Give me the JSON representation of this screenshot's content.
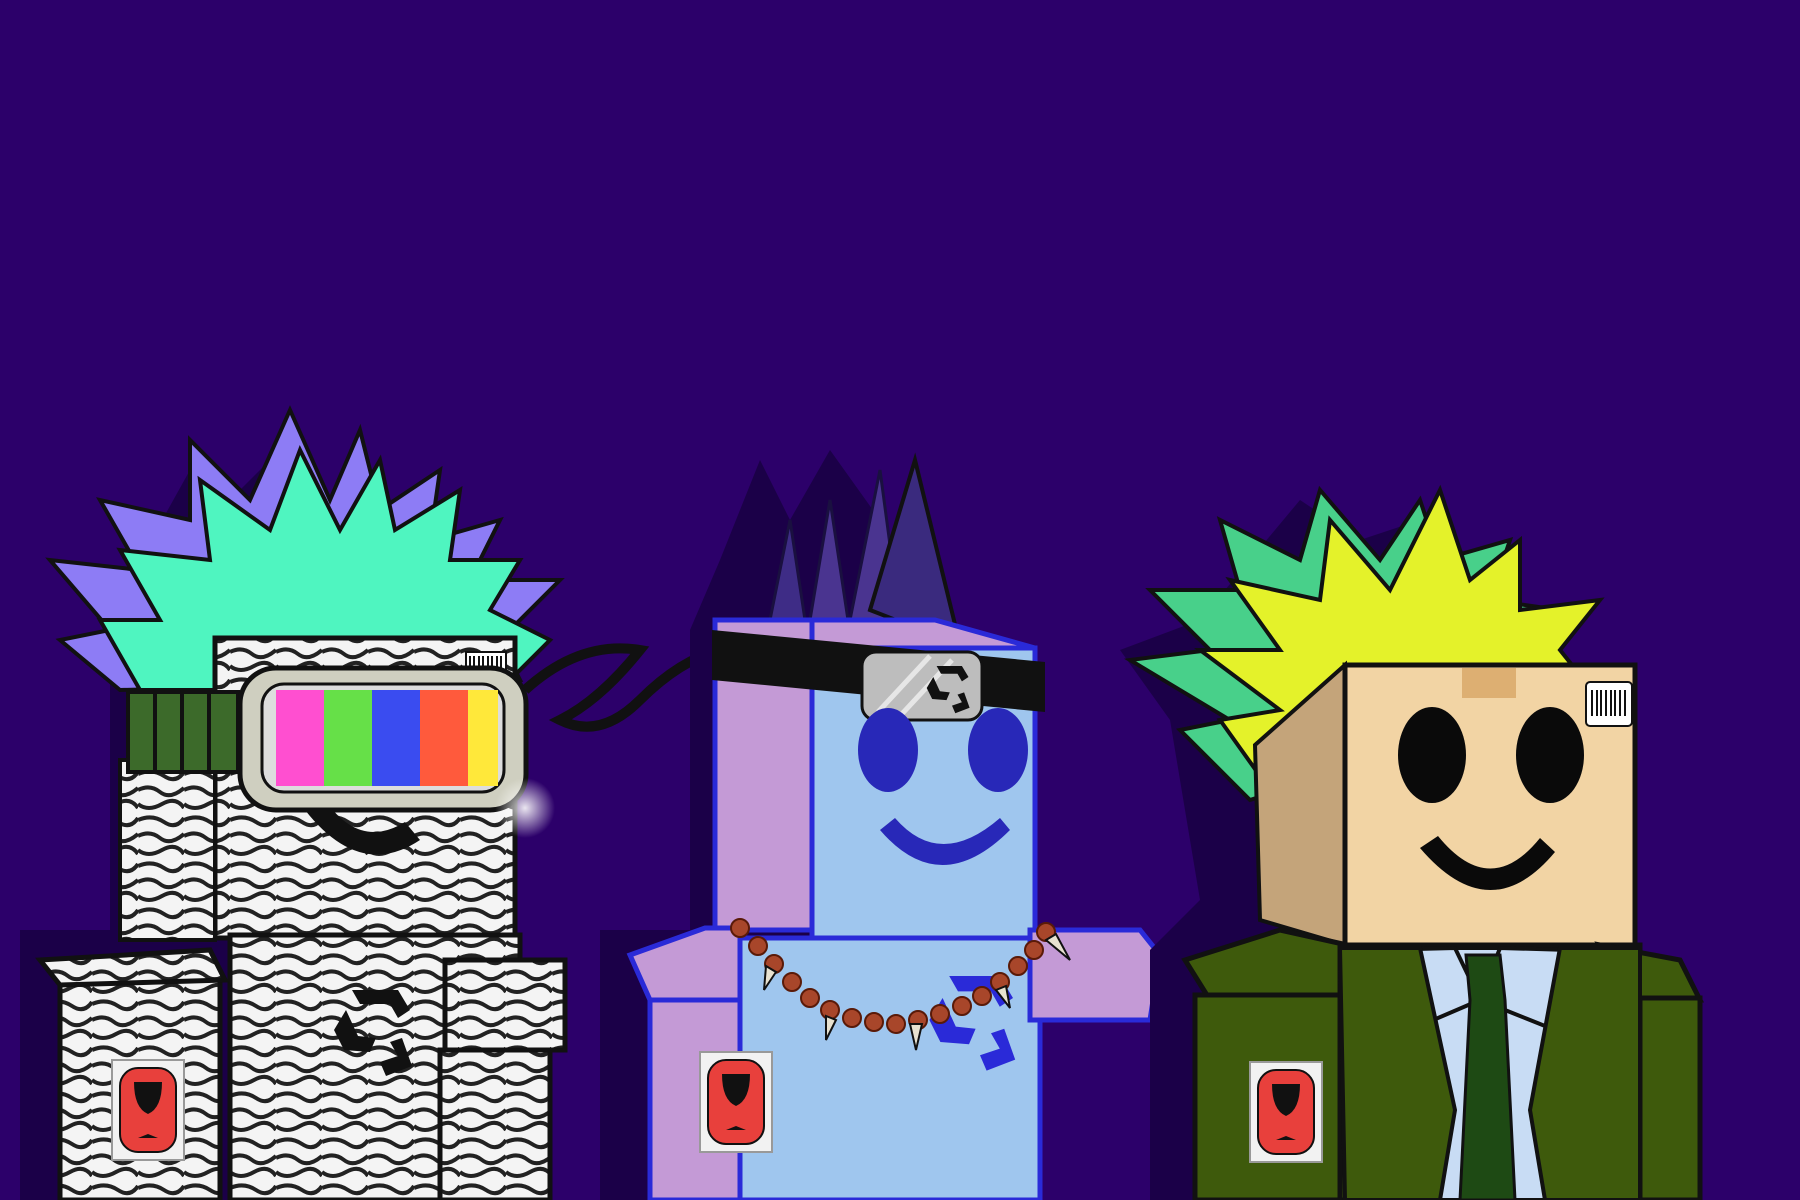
{
  "scene": {
    "background_color": "#2c006a",
    "shadow_color": "#1b0048",
    "characters": [
      {
        "name": "zebra-box-robot",
        "hair_colors": [
          "#4ff5c0",
          "#8d7cf5"
        ],
        "body_pattern": "zebra-stripes",
        "goggle_colors": [
          "#ff4fd0",
          "#66e048",
          "#3a4cf0",
          "#ff5a3c",
          "#ffe83a"
        ],
        "accessories": [
          "rainbow-visor-goggles",
          "recycle-symbol",
          "fragile-label"
        ]
      },
      {
        "name": "blue-box-robot",
        "body_color": "#9fc6ee",
        "side_color": "#c49ad6",
        "spike_color": "#3e2c86",
        "accessories": [
          "headband-with-plate",
          "bead-tooth-necklace",
          "recycle-symbol",
          "fragile-label"
        ]
      },
      {
        "name": "cardboard-box-robot",
        "hair_colors": [
          "#e4f22a",
          "#48d08a"
        ],
        "head_color": "#f2d4a4",
        "jacket_color": "#3e5a0c",
        "accessories": [
          "barcode-sticker",
          "tape-patch",
          "shirt-and-tie",
          "fragile-label"
        ]
      }
    ]
  }
}
